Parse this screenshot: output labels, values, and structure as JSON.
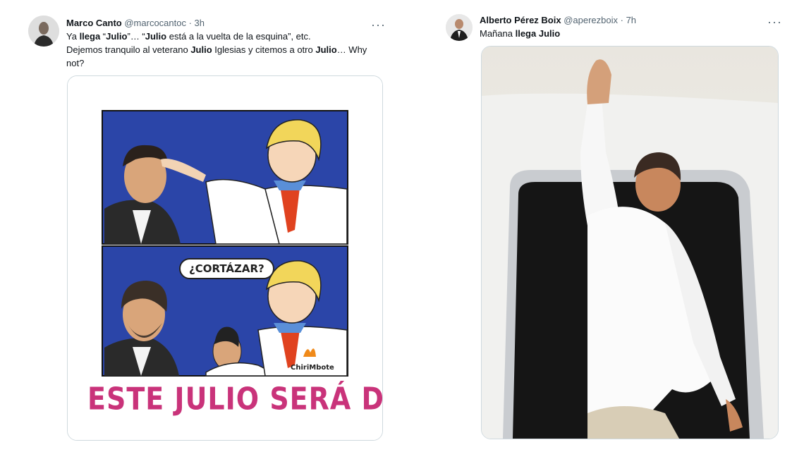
{
  "tweet1": {
    "name": "Marco Canto",
    "handle": "@marcocantoc",
    "sep": " · ",
    "time": "3h",
    "more": "···",
    "line1": {
      "a": "Ya ",
      "b": "llega",
      "c": " “",
      "d": "Julio",
      "e": "”… “",
      "f": "Julio",
      "g": " está a la vuelta de la esquina”, etc."
    },
    "line2": {
      "a": "Dejemos tranquilo al veterano ",
      "b": "Julio",
      "c": " Iglesias y citemos a otro ",
      "d": "Julio",
      "e": "…  Why"
    },
    "line3": "not?",
    "comic": {
      "bubble": "¿CORTÁZAR?",
      "logo": "ChiriMbote",
      "caption": "ESTE JULIO SERÁ DISTINTO"
    }
  },
  "tweet2": {
    "name": "Alberto Pérez Boix",
    "handle": "@aperezboix",
    "sep": " · ",
    "time": "7h",
    "more": "···",
    "text": {
      "a": "Mañana ",
      "b": "llega",
      "c": " ",
      "d": "Julio"
    }
  },
  "colors": {
    "comic_blue": "#2b45a8",
    "caption_pink": "#c9337a",
    "link_gray": "#536471",
    "border": "#cfd9de"
  }
}
